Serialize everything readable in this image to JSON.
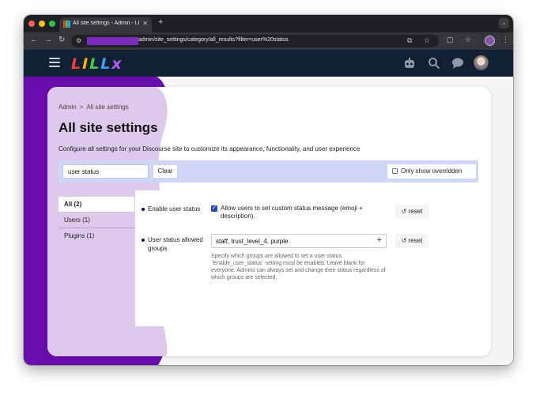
{
  "browser": {
    "tab_title": "All site settings - Admin - LILL",
    "tab_close": "✕",
    "new_tab": "+",
    "tab_menu": "⌄",
    "back": "←",
    "forward": "→",
    "reload": "↻",
    "url": "admin/site_settings/category/all_results?filter=user%20status"
  },
  "header": {
    "logo": [
      "L",
      "I",
      "L",
      "L",
      "x"
    ]
  },
  "breadcrumb": {
    "root": "Admin",
    "separator": ">",
    "current": "All site settings"
  },
  "page": {
    "title": "All site settings",
    "subtitle": "Configure all settings for your Discourse site to customize its appearance, functionality, and user experience"
  },
  "filter": {
    "value": "user status",
    "clear_label": "Clear",
    "only_overridden_label": "Only show overridden"
  },
  "nav": {
    "items": [
      {
        "label": "All",
        "count": "(2)"
      },
      {
        "label": "Users",
        "count": "(1)"
      },
      {
        "label": "Plugins",
        "count": "(1)"
      }
    ]
  },
  "settings": [
    {
      "label": "Enable user status",
      "checkbox_desc": "Allow users to set custom status message (emoji + description).",
      "reset_label": "reset"
    },
    {
      "label": "User status allowed groups",
      "value": "staff, trust_level_4, purple",
      "help": "Specify which groups are allowed to set a user status. `Enable_user_status` setting must be enabled. Leave blank for everyone. Admins can always set and change their status regardless of which groups are selected.",
      "reset_label": "reset"
    }
  ],
  "colors": {
    "brand_purple": "#6a0dad",
    "header_bg": "#112033",
    "filter_bg": "#d0d6f5",
    "checkbox_blue": "#2b4bb0"
  }
}
